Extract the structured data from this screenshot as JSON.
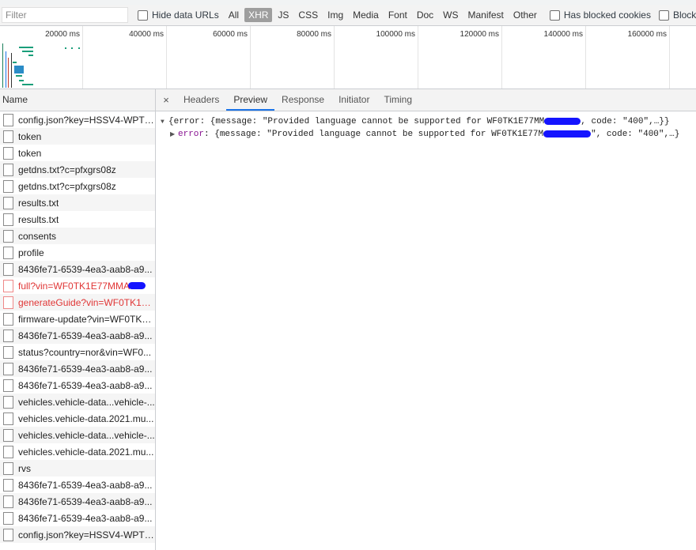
{
  "filter": {
    "placeholder": "Filter",
    "hide_data_urls": "Hide data URLs",
    "types": [
      "All",
      "XHR",
      "JS",
      "CSS",
      "Img",
      "Media",
      "Font",
      "Doc",
      "WS",
      "Manifest",
      "Other"
    ],
    "active_type": "XHR",
    "has_blocked_cookies": "Has blocked cookies",
    "blocked_requests": "Blocked Rec"
  },
  "overview": {
    "ticks": [
      "20000 ms",
      "40000 ms",
      "60000 ms",
      "80000 ms",
      "100000 ms",
      "120000 ms",
      "140000 ms",
      "160000 ms"
    ]
  },
  "requests": {
    "header": "Name",
    "rows": [
      {
        "name": "config.json?key=HSSV4-WPTF...",
        "error": false
      },
      {
        "name": "token",
        "error": false
      },
      {
        "name": "token",
        "error": false
      },
      {
        "name": "getdns.txt?c=pfxgrs08z",
        "error": false
      },
      {
        "name": "getdns.txt?c=pfxgrs08z",
        "error": false
      },
      {
        "name": "results.txt",
        "error": false
      },
      {
        "name": "results.txt",
        "error": false
      },
      {
        "name": "consents",
        "error": false
      },
      {
        "name": "profile",
        "error": false
      },
      {
        "name": "8436fe71-6539-4ea3-aab8-a9...",
        "error": false
      },
      {
        "name": "full?vin=WF0TK1E77MMA",
        "error": true
      },
      {
        "name": "generateGuide?vin=WF0TK1E...",
        "error": true
      },
      {
        "name": "firmware-update?vin=WF0TK1...",
        "error": false
      },
      {
        "name": "8436fe71-6539-4ea3-aab8-a9...",
        "error": false
      },
      {
        "name": "status?country=nor&vin=WF0...",
        "error": false
      },
      {
        "name": "8436fe71-6539-4ea3-aab8-a9...",
        "error": false
      },
      {
        "name": "8436fe71-6539-4ea3-aab8-a9...",
        "error": false
      },
      {
        "name": "vehicles.vehicle-data...vehicle-...",
        "error": false
      },
      {
        "name": "vehicles.vehicle-data.2021.mu...",
        "error": false
      },
      {
        "name": "vehicles.vehicle-data...vehicle-...",
        "error": false
      },
      {
        "name": "vehicles.vehicle-data.2021.mu...",
        "error": false
      },
      {
        "name": "rvs",
        "error": false
      },
      {
        "name": "8436fe71-6539-4ea3-aab8-a9...",
        "error": false
      },
      {
        "name": "8436fe71-6539-4ea3-aab8-a9...",
        "error": false
      },
      {
        "name": "8436fe71-6539-4ea3-aab8-a9...",
        "error": false
      },
      {
        "name": "config.json?key=HSSV4-WPTF...",
        "error": false
      }
    ]
  },
  "details": {
    "close": "×",
    "tabs": [
      "Headers",
      "Preview",
      "Response",
      "Initiator",
      "Timing"
    ],
    "active_tab": "Preview",
    "line1_pre": "{error: {message: \"Provided language cannot be supported for WF0TK1E77MM",
    "line1_post": ", code: \"400\",…}}",
    "line2_key": "error",
    "line2_pre": ": {message: \"Provided language cannot be supported for WF0TK1E77M",
    "line2_post": "\", code: \"400\",…}"
  },
  "colors": {
    "error_text": "#e03636",
    "active_tab_underline": "#1a73e8",
    "redaction": "#1414ff",
    "json_key": "#881391"
  }
}
